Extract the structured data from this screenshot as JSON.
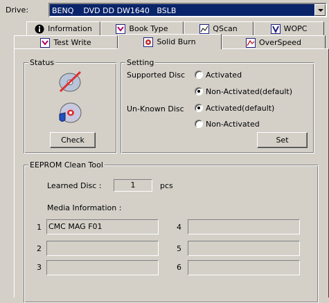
{
  "drive": {
    "label": "Drive:",
    "selected": "BENQ    DVD DD DW1640   BSLB"
  },
  "tabs_row1": [
    {
      "label": "Information",
      "icon": "info-icon"
    },
    {
      "label": "Book Type",
      "icon": "book-icon"
    },
    {
      "label": "QScan",
      "icon": "chart-icon"
    },
    {
      "label": "WOPC",
      "icon": "wopc-icon"
    }
  ],
  "tabs_row2": [
    {
      "label": "Test Write",
      "icon": "test-write-icon"
    },
    {
      "label": "Solid Burn",
      "icon": "solid-burn-icon",
      "active": true
    },
    {
      "label": "OverSpeed",
      "icon": "overspeed-icon"
    }
  ],
  "status": {
    "title": "Status",
    "icons": [
      "disc-disabled-icon",
      "disc-shield-icon"
    ],
    "check_label": "Check"
  },
  "setting": {
    "title": "Setting",
    "supported_label": "Supported Disc",
    "supported_options": [
      "Activated",
      "Non-Activated(default)"
    ],
    "supported_selected": 1,
    "unknown_label": "Un-Known Disc",
    "unknown_options": [
      "Activated(default)",
      "Non-Activated"
    ],
    "unknown_selected": 0,
    "set_label": "Set"
  },
  "eeprom": {
    "title": "EEPROM Clean Tool",
    "learned_label": "Learned Disc :",
    "learned_value": "1",
    "learned_unit": "pcs",
    "media_label": "Media Information :",
    "media": [
      {
        "num": "1",
        "value": "CMC MAG F01"
      },
      {
        "num": "2",
        "value": ""
      },
      {
        "num": "3",
        "value": ""
      },
      {
        "num": "4",
        "value": ""
      },
      {
        "num": "5",
        "value": ""
      },
      {
        "num": "6",
        "value": ""
      }
    ]
  },
  "colors": {
    "face": "#d4d0c8",
    "highlight": "#0a246a"
  }
}
